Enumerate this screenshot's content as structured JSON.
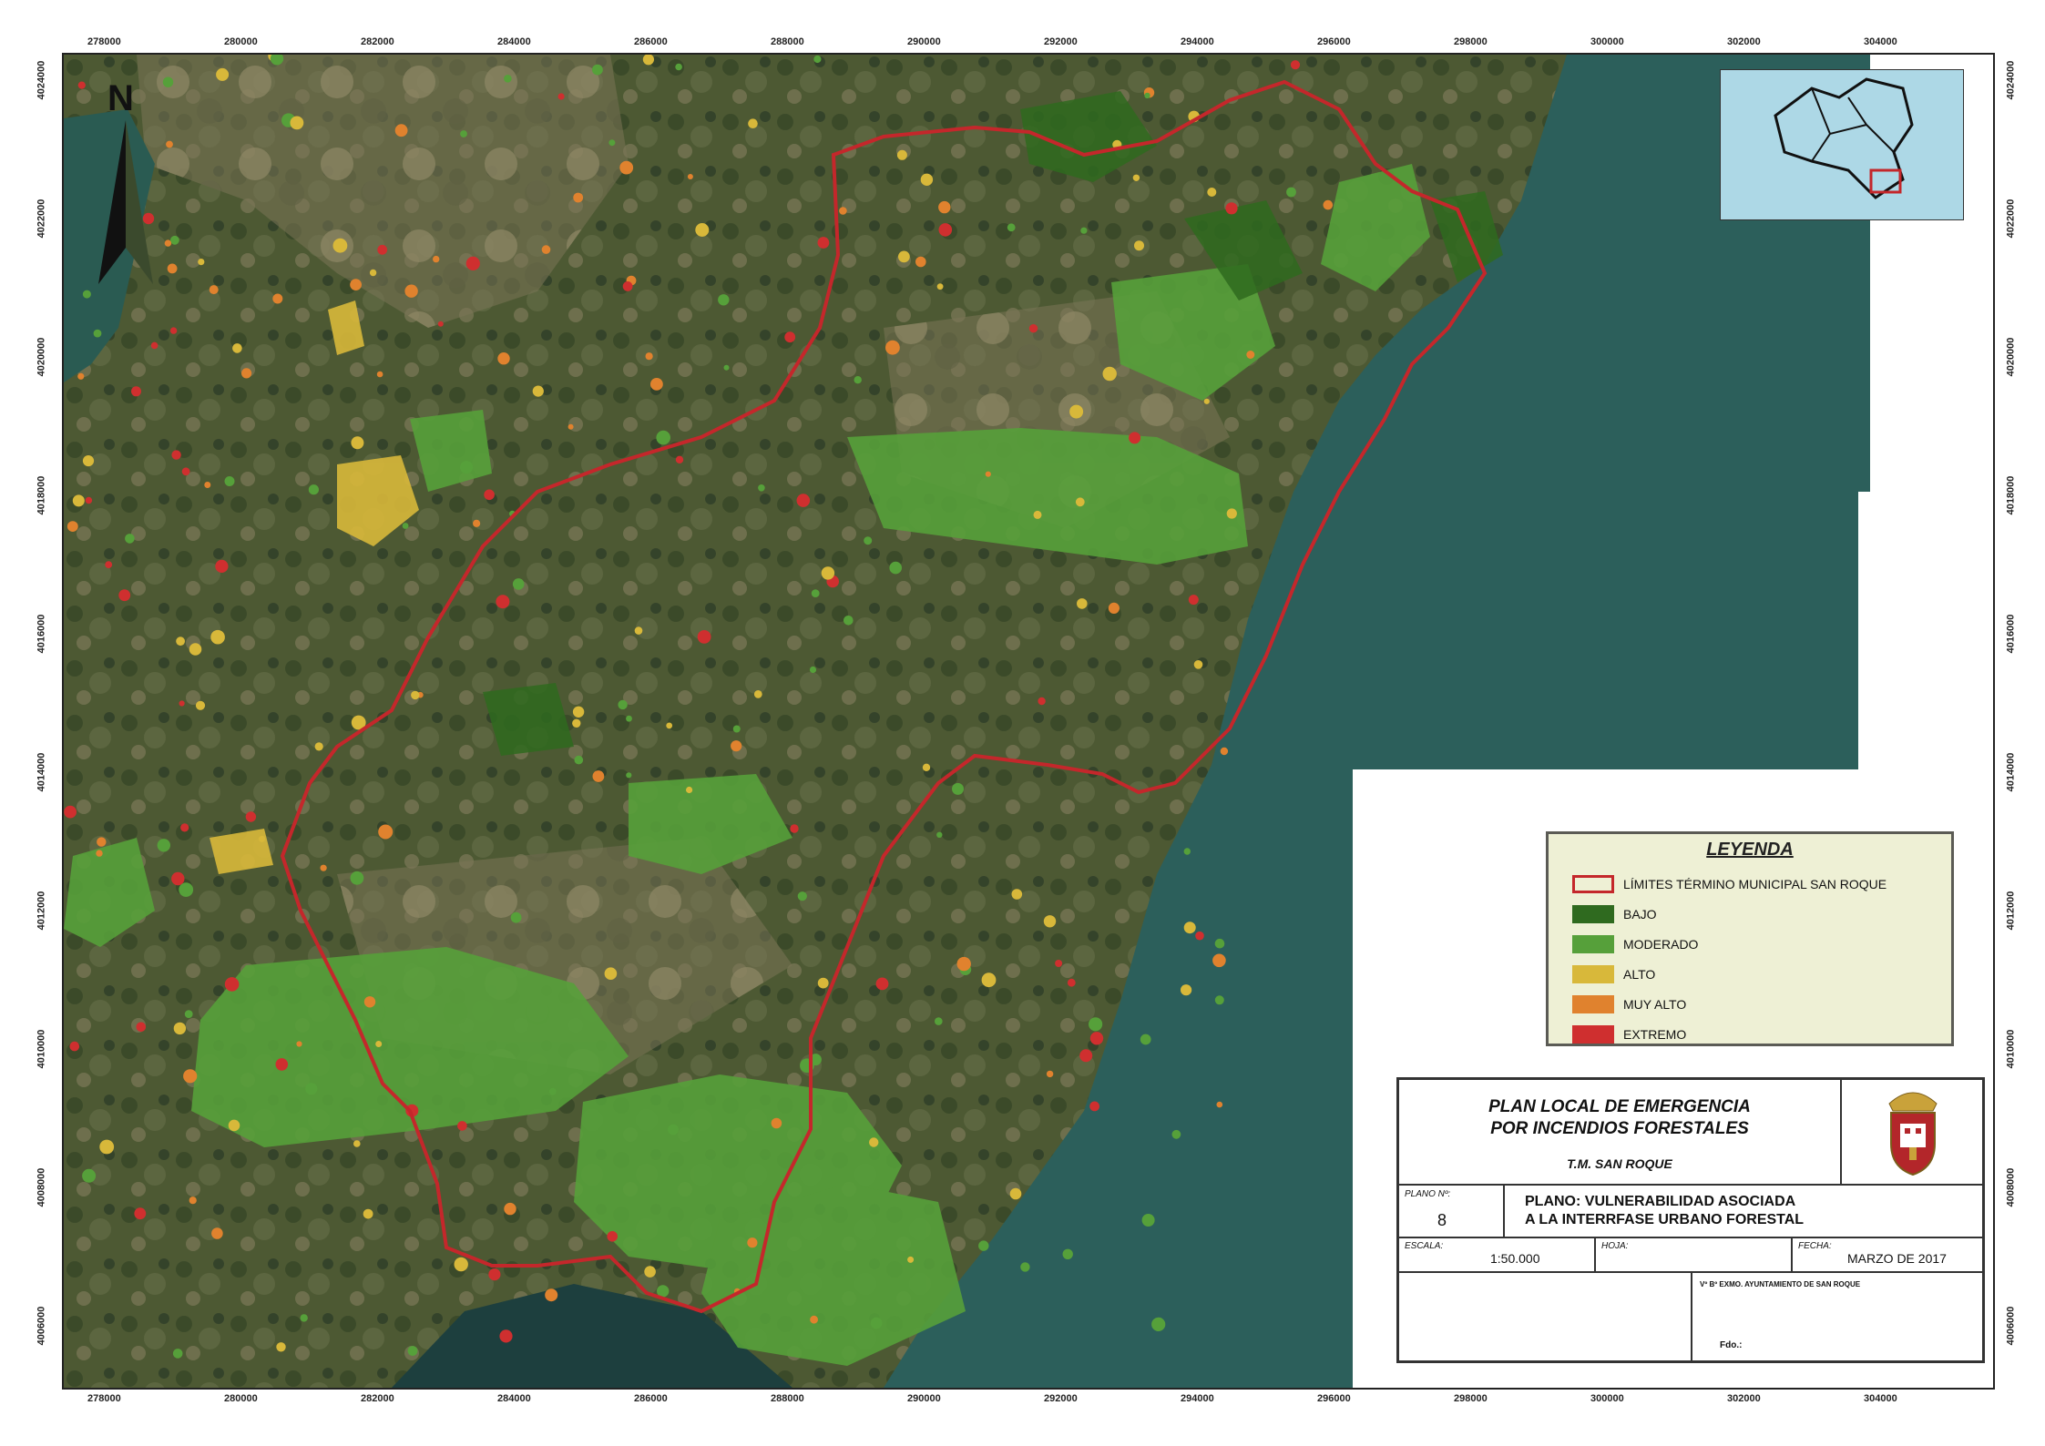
{
  "coords": {
    "x_labels": [
      "278000",
      "280000",
      "282000",
      "284000",
      "286000",
      "288000",
      "290000",
      "292000",
      "294000",
      "296000",
      "298000",
      "300000",
      "302000",
      "304000"
    ],
    "y_labels": [
      "4024000",
      "4022000",
      "4020000",
      "4018000",
      "4016000",
      "4014000",
      "4012000",
      "4010000",
      "4008000",
      "4006000"
    ]
  },
  "north_arrow": {
    "label": "N",
    "icon": "north-arrow-icon"
  },
  "legend": {
    "title": "LEYENDA",
    "items": [
      {
        "label": "LÍMITES TÉRMINO MUNICIPAL SAN ROQUE",
        "color": "#c4272b",
        "outline": true
      },
      {
        "label": "BAJO",
        "color": "#2f6a1f",
        "outline": false
      },
      {
        "label": "MODERADO",
        "color": "#56a03a",
        "outline": false
      },
      {
        "label": "ALTO",
        "color": "#d8b83a",
        "outline": false
      },
      {
        "label": "MUY ALTO",
        "color": "#e0822e",
        "outline": false
      },
      {
        "label": "EXTREMO",
        "color": "#cf2f2f",
        "outline": false
      }
    ]
  },
  "title_block": {
    "title_line1": "PLAN LOCAL DE EMERGENCIA",
    "title_line2": "POR INCENDIOS FORESTALES",
    "municipality": "T.M. SAN ROQUE",
    "plano_label": "PLANO Nº:",
    "plano_number": "8",
    "plano_title_line1": "PLANO: VULNERABILIDAD ASOCIADA",
    "plano_title_line2": "A LA INTERRFASE URBANO FORESTAL",
    "escala_label": "ESCALA:",
    "escala_value": "1:50.000",
    "hoja_label": "HOJA:",
    "fecha_label": "FECHA:",
    "fecha_value": "MARZO DE 2017",
    "approval": "Vº Bº EXMO. AYUNTAMIENTO DE SAN ROQUE",
    "fdo": "Fdo.:",
    "crest_icon": "coat-of-arms-icon"
  },
  "colors": {
    "sea": "#2b5e5c",
    "boundary": "#c4272b",
    "terrain_dark": "#3e4b2c",
    "terrain_light": "#8a8462"
  }
}
